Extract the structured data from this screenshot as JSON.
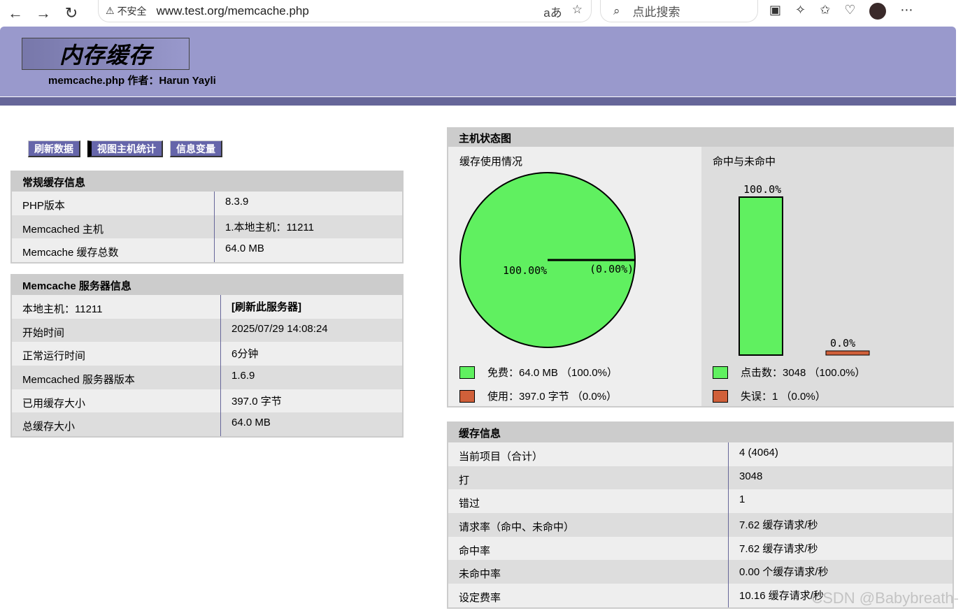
{
  "browser": {
    "url": "www.test.org/memcache.php",
    "insecure_label": "不安全",
    "search_placeholder": "点此搜索"
  },
  "header": {
    "logo": "内存缓存",
    "subtitle": "memcache.php 作者：Harun Yayli"
  },
  "menu": [
    "刷新数据",
    "视图主机统计",
    "信息变量"
  ],
  "general": {
    "title": "常规缓存信息",
    "rows": [
      {
        "label": "PHP版本",
        "value": "8.3.9"
      },
      {
        "label": "Memcached 主机",
        "value": "1.本地主机：11211"
      },
      {
        "label": "Memcache 缓存总数",
        "value": "64.0 MB"
      }
    ]
  },
  "server": {
    "title": "Memcache 服务器信息",
    "rows": [
      {
        "label": "本地主机：11211",
        "value": "[刷新此服务器]"
      },
      {
        "label": "开始时间",
        "value": "2025/07/29 14:08:24"
      },
      {
        "label": "正常运行时间",
        "value": "6分钟"
      },
      {
        "label": "Memcached 服务器版本",
        "value": "1.6.9"
      },
      {
        "label": "已用缓存大小",
        "value": "397.0 字节"
      },
      {
        "label": "总缓存大小",
        "value": "64.0 MB"
      }
    ]
  },
  "graphs": {
    "title": "主机状态图",
    "usage": {
      "title": "缓存使用情况",
      "free_pct_label": "100.00%",
      "used_pct_label": "(0.00%)",
      "free_fraction": 1.0,
      "legend_free": "免费：64.0 MB （100.0%）",
      "legend_used": "使用：397.0 字节 （0.0%）"
    },
    "hits": {
      "title": "命中与未命中",
      "hit_label": "100.0%",
      "miss_label": "0.0%",
      "hit_fraction": 1.0,
      "miss_fraction": 0.0,
      "legend_hits": "点击数：3048 （100.0%）",
      "legend_misses": "失误：1 （0.0%）"
    },
    "colors": {
      "green": "#60f060",
      "orange": "#d0603a"
    }
  },
  "cache": {
    "title": "缓存信息",
    "rows": [
      {
        "label": "当前项目（合计）",
        "value": "4 (4064)"
      },
      {
        "label": "打",
        "value": "3048"
      },
      {
        "label": "错过",
        "value": "1"
      },
      {
        "label": "请求率（命中、未命中）",
        "value": "7.62 缓存请求/秒"
      },
      {
        "label": "命中率",
        "value": "7.62 缓存请求/秒"
      },
      {
        "label": "未命中率",
        "value": "0.00 个缓存请求/秒"
      },
      {
        "label": "设定费率",
        "value": "10.16 缓存请求/秒"
      }
    ]
  },
  "watermark": "CSDN @Babybreath-"
}
